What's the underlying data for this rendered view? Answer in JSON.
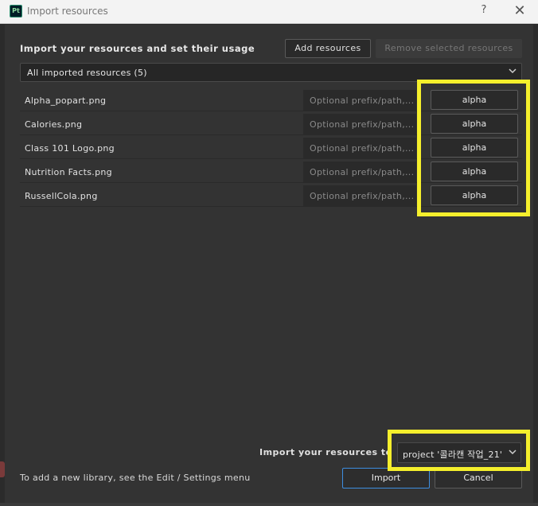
{
  "window": {
    "app_icon": "Pt",
    "title": "Import resources",
    "help_label": "?",
    "close_label": "✕"
  },
  "header": {
    "heading": "Import your resources and set their usage",
    "add_button": "Add resources",
    "remove_button": "Remove selected resources"
  },
  "filter": {
    "selected": "All imported resources (5)"
  },
  "resources": [
    {
      "name": "Alpha_popart.png",
      "prefix_placeholder": "Optional prefix/path,...",
      "usage": "alpha"
    },
    {
      "name": "Calories.png",
      "prefix_placeholder": "Optional prefix/path,...",
      "usage": "alpha"
    },
    {
      "name": "Class 101 Logo.png",
      "prefix_placeholder": "Optional prefix/path,...",
      "usage": "alpha"
    },
    {
      "name": "Nutrition Facts.png",
      "prefix_placeholder": "Optional prefix/path,...",
      "usage": "alpha"
    },
    {
      "name": "RussellCola.png",
      "prefix_placeholder": "Optional prefix/path,...",
      "usage": "alpha"
    }
  ],
  "footer": {
    "import_to_label": "Import your resources to",
    "target_selected": "project '콜라캔 작업_21'",
    "footnote": "To add a new library, see the Edit / Settings menu",
    "import_button": "Import",
    "cancel_button": "Cancel"
  },
  "colors": {
    "highlight": "#f5ef2c",
    "accent": "#3d8ee0",
    "background": "#333333"
  }
}
